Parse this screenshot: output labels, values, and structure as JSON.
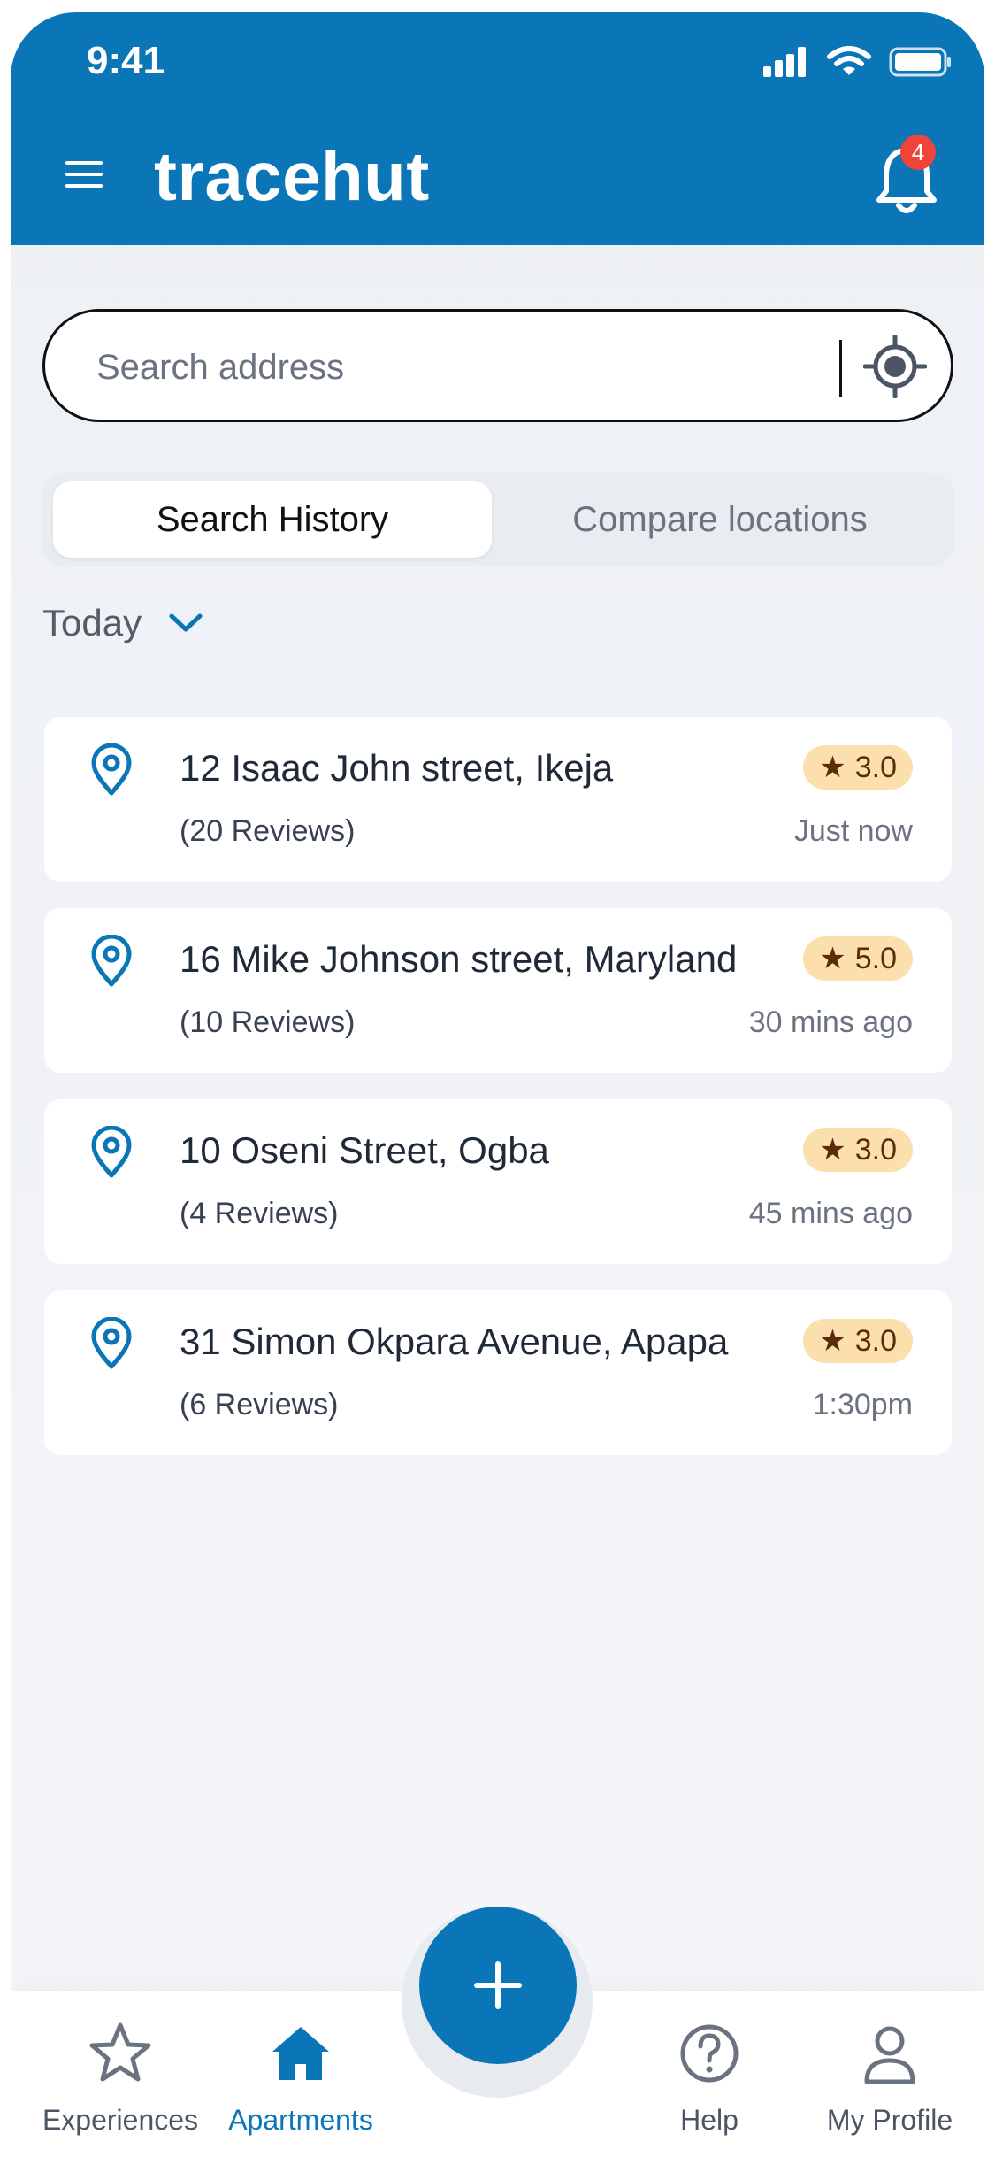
{
  "status_bar": {
    "time": "9:41"
  },
  "header": {
    "title": "tracehut",
    "notification_count": "4"
  },
  "search": {
    "placeholder": "Search address"
  },
  "segmented": {
    "active": "Search History",
    "inactive": "Compare locations"
  },
  "filter": {
    "label": "Today"
  },
  "history": [
    {
      "address": "12 Isaac John street, Ikeja",
      "reviews": "(20 Reviews)",
      "rating": "3.0",
      "time": "Just now"
    },
    {
      "address": "16 Mike Johnson street, Maryland",
      "reviews": "(10 Reviews)",
      "rating": "5.0",
      "time": "30 mins ago"
    },
    {
      "address": "10 Oseni Street, Ogba",
      "reviews": "(4 Reviews)",
      "rating": "3.0",
      "time": "45 mins ago"
    },
    {
      "address": "31 Simon Okpara Avenue, Apapa",
      "reviews": "(6 Reviews)",
      "rating": "3.0",
      "time": "1:30pm"
    }
  ],
  "tabbar": {
    "experiences": "Experiences",
    "apartments": "Apartments",
    "help": "Help",
    "profile": "My Profile"
  },
  "colors": {
    "brand": "#0a75b7",
    "badge": "#f04438",
    "rating_bg": "#fbe0ad"
  }
}
